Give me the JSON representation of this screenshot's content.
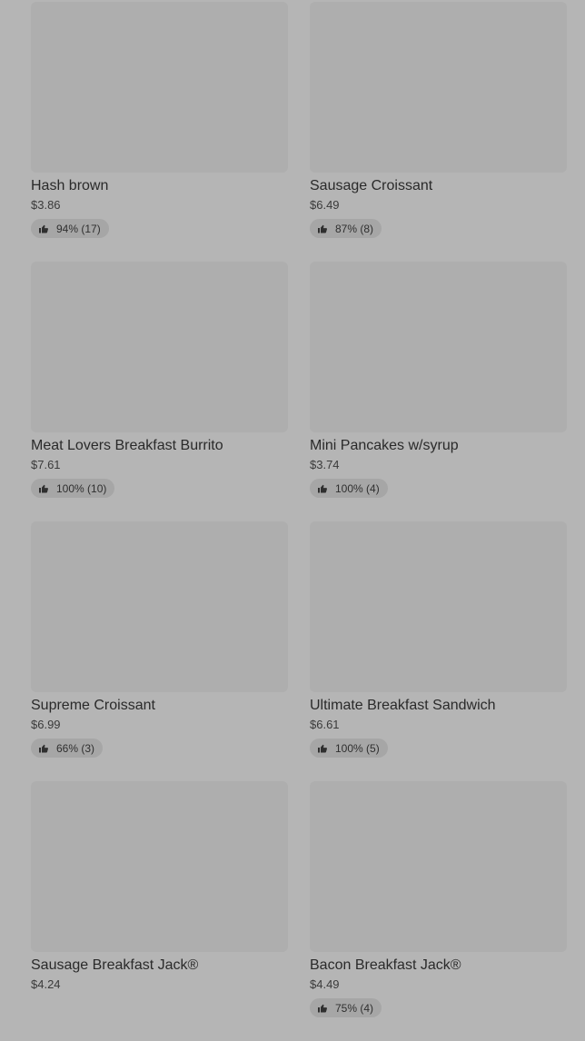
{
  "items": [
    {
      "name": "Hash brown",
      "price": "$3.86",
      "rating": "94% (17)"
    },
    {
      "name": "Sausage Croissant",
      "price": "$6.49",
      "rating": "87% (8)"
    },
    {
      "name": "Meat Lovers Breakfast Burrito",
      "price": "$7.61",
      "rating": "100% (10)"
    },
    {
      "name": "Mini Pancakes w/syrup",
      "price": "$3.74",
      "rating": "100% (4)"
    },
    {
      "name": "Supreme Croissant",
      "price": "$6.99",
      "rating": "66% (3)"
    },
    {
      "name": "Ultimate Breakfast Sandwich",
      "price": "$6.61",
      "rating": "100% (5)"
    },
    {
      "name": "Sausage Breakfast Jack®",
      "price": "$4.24"
    },
    {
      "name": "Bacon Breakfast Jack®",
      "price": "$4.49",
      "rating": "75% (4)"
    }
  ],
  "colors": {
    "background": "#b5b5b5",
    "image_placeholder": "#aeaeae",
    "rating_pill": "#a6a6a6"
  },
  "icons": {
    "rating": "thumbs-up-icon"
  }
}
